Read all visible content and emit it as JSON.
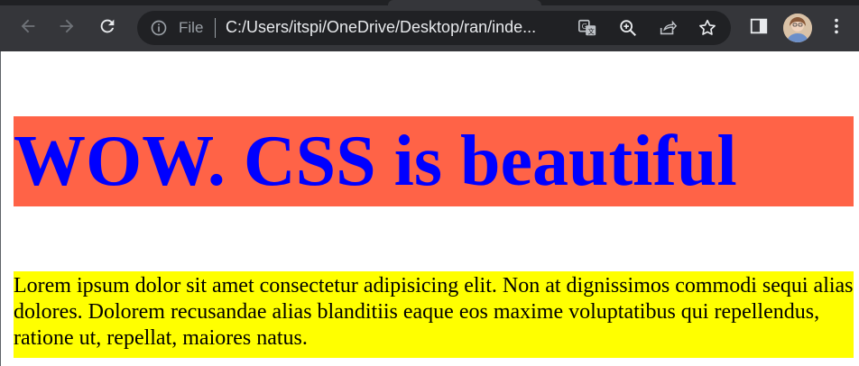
{
  "browser": {
    "file_label": "File",
    "url": "C:/Users/itspi/OneDrive/Desktop/ran/inde...",
    "toolbar_bg": "#35363a",
    "omnibox_bg": "#202124"
  },
  "page": {
    "heading": "WOW. CSS is beautiful",
    "heading_bg": "#ff6347",
    "heading_color": "#0000ff",
    "paragraph": "Lorem ipsum dolor sit amet consectetur adipisicing elit. Non at dignissimos commodi sequi alias dolores. Dolorem recusandae alias blanditiis eaque eos maxime voluptatibus qui repellendus, ratione ut, repellat, maiores natus.",
    "paragraph_bg": "#ffff00"
  },
  "icons": {
    "back": "back-arrow-icon",
    "forward": "forward-arrow-icon",
    "reload": "reload-icon",
    "info": "info-icon",
    "translate": "translate-icon",
    "zoom": "zoom-icon",
    "share": "share-icon",
    "bookmark": "star-icon",
    "side_panel": "side-panel-icon",
    "profile": "avatar",
    "menu": "kebab-menu-icon"
  }
}
